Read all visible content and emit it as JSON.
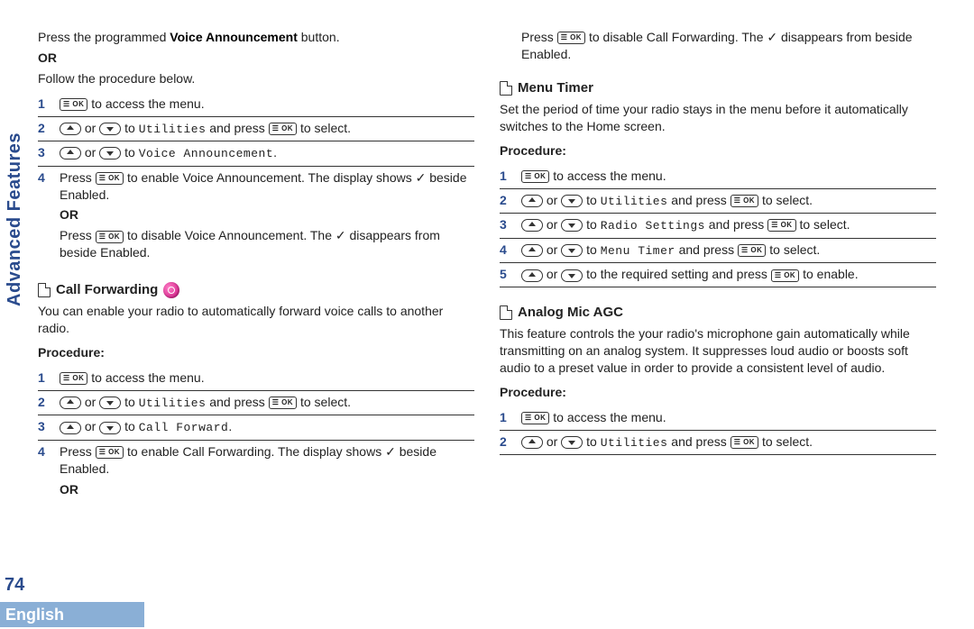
{
  "meta": {
    "sidebar_label": "Advanced Features",
    "page_number": "74",
    "language_bar": "English"
  },
  "left": {
    "intro": {
      "line1_pre": "Press the programmed ",
      "line1_bold": "Voice Announcement",
      "line1_post": " button.",
      "or": "OR",
      "line2": "Follow the procedure below."
    },
    "va_steps": {
      "s1_post": " to access the menu.",
      "s2_mid": " or ",
      "s2_to": " to ",
      "s2_target": "Utilities",
      "s2_press": " and press ",
      "s2_end": " to select.",
      "s3_mid": " or ",
      "s3_to": " to ",
      "s3_target": "Voice Announcement",
      "s3_end": ".",
      "s4_pre": "Press ",
      "s4_mid": " to enable Voice Announcement. The display shows ",
      "s4_check": "✓",
      "s4_post": " beside Enabled.",
      "s4_or": "OR",
      "s4b_pre": "Press ",
      "s4b_mid": " to disable Voice Announcement. The ",
      "s4b_check": "✓",
      "s4b_post": " disappears from beside Enabled."
    },
    "cf": {
      "title": "Call Forwarding",
      "desc": "You can enable your radio to automatically forward voice calls to another radio.",
      "procedure": "Procedure:",
      "s1_post": " to access the menu.",
      "s2_mid": " or ",
      "s2_to": " to ",
      "s2_target": "Utilities",
      "s2_press": " and press ",
      "s2_end": " to select.",
      "s3_mid": " or ",
      "s3_to": " to ",
      "s3_target": "Call Forward",
      "s3_end": ".",
      "s4_pre": "Press ",
      "s4_mid": " to enable Call Forwarding. The display shows ",
      "s4_check": "✓",
      "s4_post": " beside Enabled.",
      "s4_or": "OR"
    }
  },
  "right": {
    "cf_cont": {
      "pre": "Press ",
      "mid": " to disable Call Forwarding. The ",
      "check": "✓",
      "post": " disappears from beside Enabled."
    },
    "mt": {
      "title": "Menu Timer",
      "desc": "Set the period of time your radio stays in the menu before it automatically switches to the Home screen.",
      "procedure": "Procedure:",
      "s1_post": " to access the menu.",
      "s2_mid": " or ",
      "s2_to": " to ",
      "s2_target": "Utilities",
      "s2_press": " and press ",
      "s2_end": " to select.",
      "s3_mid": " or ",
      "s3_to": " to ",
      "s3_target": "Radio Settings",
      "s3_press": " and press ",
      "s3_end": " to select.",
      "s4_mid": " or ",
      "s4_to": " to ",
      "s4_target": "Menu Timer",
      "s4_press": " and press ",
      "s4_end": " to select.",
      "s5_mid": " or ",
      "s5_to": " to the required setting and press ",
      "s5_end": " to enable."
    },
    "agc": {
      "title": "Analog Mic AGC",
      "desc": "This feature controls the your radio's microphone gain automatically while transmitting on an analog system. It suppresses loud audio or boosts soft audio to a preset value in order to provide a consistent level of audio.",
      "procedure": "Procedure:",
      "s1_post": " to access the menu.",
      "s2_mid": " or ",
      "s2_to": " to ",
      "s2_target": "Utilities",
      "s2_press": " and press ",
      "s2_end": " to select."
    }
  },
  "keys": {
    "ok": "☰ OK"
  }
}
